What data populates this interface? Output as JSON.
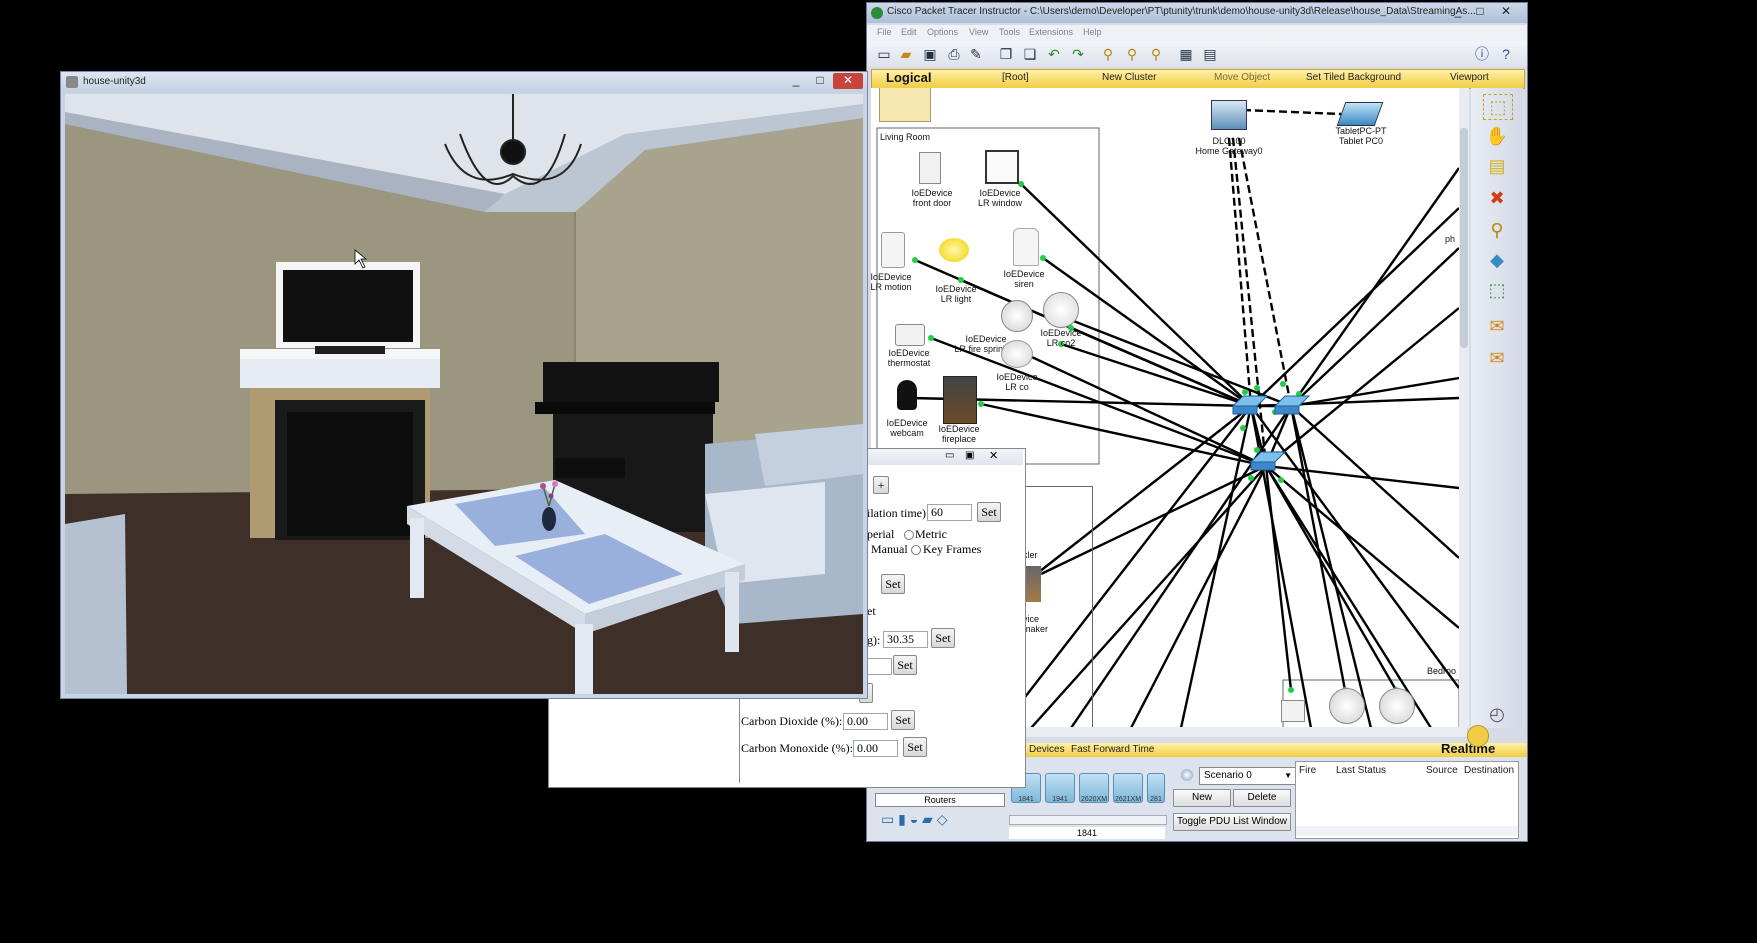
{
  "unity_window": {
    "title": "house-unity3d",
    "controls": [
      "_",
      "□",
      "✕"
    ]
  },
  "pt_window": {
    "title": "Cisco Packet Tracer Instructor - C:\\Users\\demo\\Developer\\PT\\ptunity\\trunk\\demo\\house-unity3d\\Release\\house_Data\\StreamingAs...",
    "controls": [
      "_",
      "□",
      "✕"
    ],
    "menu": [
      "File",
      "Edit",
      "Options",
      "View",
      "Tools",
      "Extensions",
      "Help"
    ],
    "navbar": {
      "logical": "Logical",
      "root": "[Root]",
      "new_cluster": "New Cluster",
      "move_object": "Move Object",
      "set_tiled_background": "Set Tiled Background",
      "viewport": "Viewport"
    },
    "canvas": {
      "living_room_label": "Living Room",
      "bedroom_label": "Bedroo",
      "devices": {
        "front_door": [
          "IoEDevice",
          "front door"
        ],
        "lr_window": [
          "IoEDevice",
          "LR window"
        ],
        "lr_motion": [
          "IoEDevice",
          "LR motion"
        ],
        "lr_light": [
          "IoEDevice",
          "LR light"
        ],
        "siren": [
          "IoEDevice",
          "siren"
        ],
        "lr_fire_sprinkler": [
          "IoEDevice",
          "LR fire sprinkler"
        ],
        "lr_co2": [
          "IoEDevice",
          "LR co2"
        ],
        "thermostat": [
          "IoEDevice",
          "thermostat"
        ],
        "lr_co": [
          "IoEDevice",
          "LR co"
        ],
        "webcam": [
          "IoEDevice",
          "webcam"
        ],
        "fireplace": [
          "IoEDevice",
          "fireplace"
        ],
        "home_gateway": [
          "DLC100",
          "Home Gateway0"
        ],
        "tablet": [
          "TabletPC-PT",
          "Tablet PC0"
        ],
        "kler": "kler",
        "maker": [
          "vice",
          "maker"
        ],
        "ph": "ph"
      }
    },
    "bottom": {
      "mode_left": "Devices",
      "fast_forward": "Fast Forward Time",
      "realtime": "Realtime",
      "device_models": [
        "1841",
        "1941",
        "2620XM",
        "2621XM",
        "281"
      ],
      "category": "Routers",
      "selected_model": "1841",
      "scenario": "Scenario 0",
      "new_button": "New",
      "delete_button": "Delete",
      "toggle_pdu": "Toggle PDU List Window",
      "pdu_columns": [
        "Fire",
        "Last Status",
        "Source",
        "Destination"
      ]
    }
  },
  "config_dialog": {
    "plus": "+",
    "rows": [
      {
        "label": "ilation time):",
        "value": "60",
        "button": "Set"
      },
      {
        "label": "perial",
        "radio2": "Metric"
      },
      {
        "label": "Manual",
        "radio2": "Key Frames"
      },
      {
        "button_only": "Set"
      },
      {
        "label": "et"
      },
      {
        "label": "g):",
        "value": "30.35",
        "button": "Set"
      },
      {
        "value": "",
        "button": "Set"
      },
      {
        "label": "Carbon Dioxide (%):",
        "value": "0.00",
        "button": "Set"
      },
      {
        "label": "Carbon Monoxide (%):",
        "value": "0.00",
        "button": "Set"
      }
    ]
  },
  "colors": {
    "pt_navbar": "#f0cd45",
    "link_green": "#22cc44",
    "switch_blue": "#3d88c9",
    "wall": "#9a9680",
    "carpet": "#3e2f28"
  }
}
